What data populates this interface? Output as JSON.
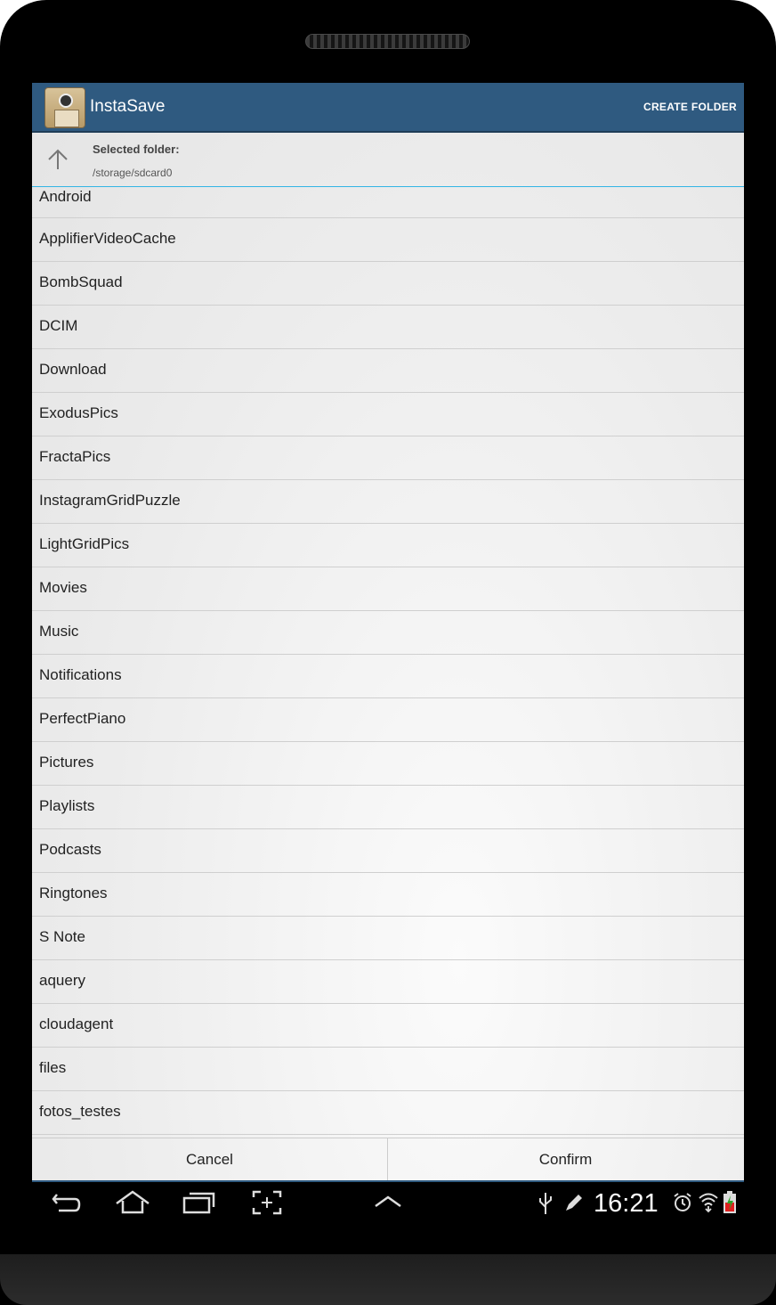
{
  "app": {
    "title": "InstaSave",
    "create_folder_label": "CREATE FOLDER"
  },
  "header": {
    "selected_label": "Selected folder:",
    "selected_path": "/storage/sdcard0"
  },
  "folders": [
    "Android",
    "ApplifierVideoCache",
    "BombSquad",
    "DCIM",
    "Download",
    "ExodusPics",
    "FractaPics",
    "InstagramGridPuzzle",
    "LightGridPics",
    "Movies",
    "Music",
    "Notifications",
    "PerfectPiano",
    "Pictures",
    "Playlists",
    "Podcasts",
    "Ringtones",
    "S Note",
    "aquery",
    "cloudagent",
    "files",
    "fotos_testes"
  ],
  "buttons": {
    "cancel": "Cancel",
    "confirm": "Confirm"
  },
  "status_bar": {
    "time": "16:21"
  },
  "colors": {
    "action_bar": "#2f5a80",
    "accent": "#33b5e5"
  },
  "icons": [
    "app-icon",
    "up-arrow-icon",
    "back-icon",
    "home-icon",
    "recent-apps-icon",
    "screenshot-icon",
    "menu-up-icon",
    "usb-icon",
    "edit-icon",
    "alarm-icon",
    "wifi-icon",
    "battery-icon"
  ]
}
